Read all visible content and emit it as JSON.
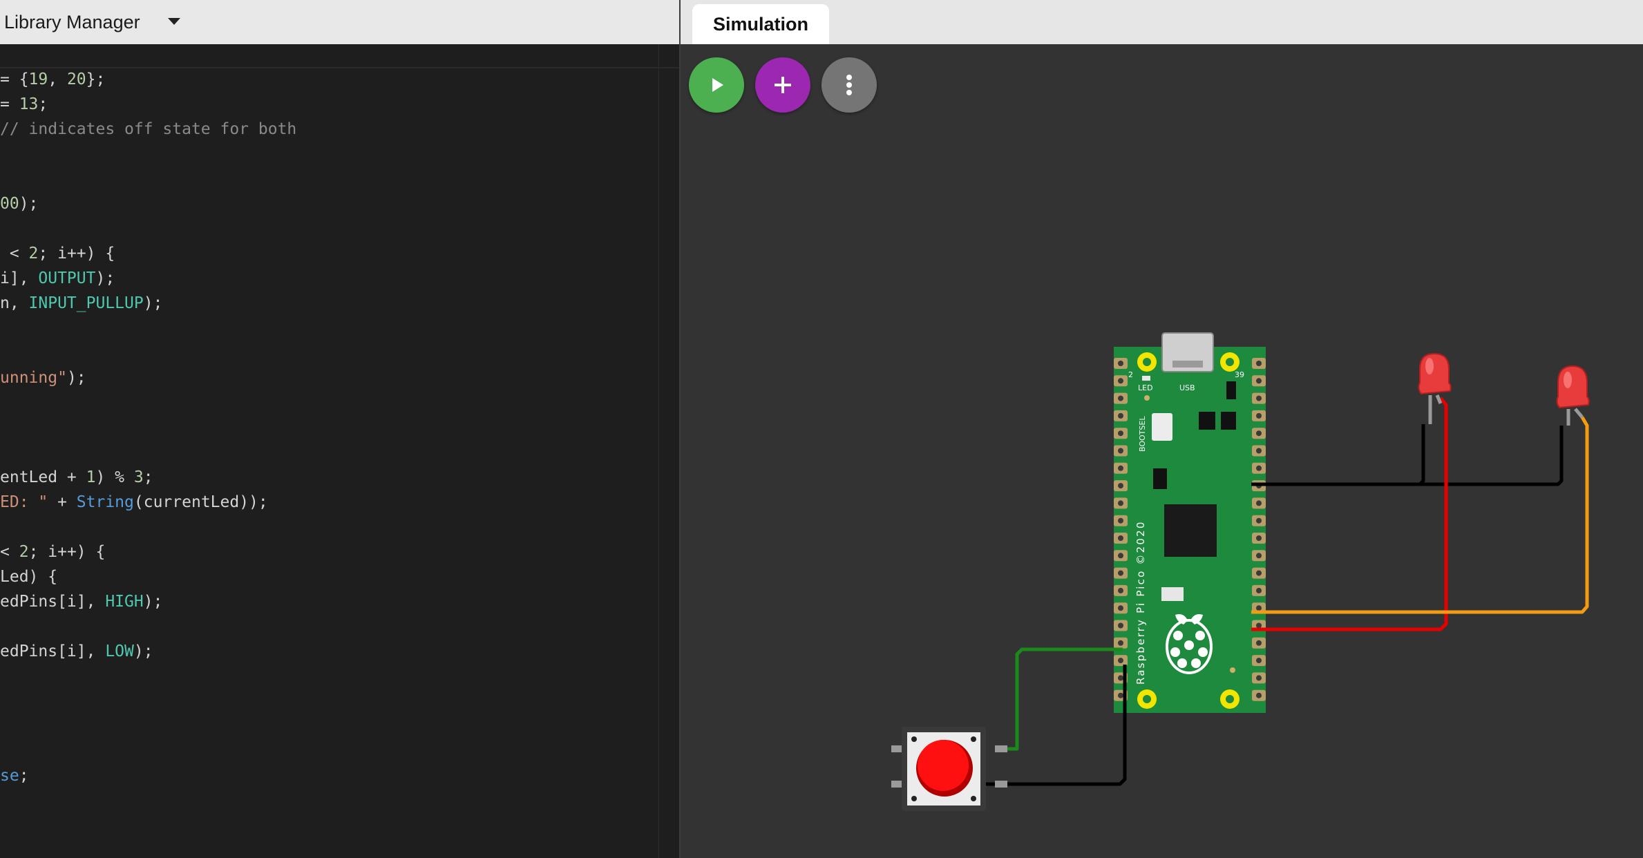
{
  "left_panel": {
    "tab_label": "Library Manager",
    "code_lines": [
      [
        {
          "t": "= {",
          "c": "plain"
        },
        {
          "t": "19",
          "c": "num"
        },
        {
          "t": ", ",
          "c": "plain"
        },
        {
          "t": "20",
          "c": "num"
        },
        {
          "t": "};",
          "c": "plain"
        }
      ],
      [
        {
          "t": "= ",
          "c": "plain"
        },
        {
          "t": "13",
          "c": "num"
        },
        {
          "t": ";",
          "c": "plain"
        }
      ],
      [
        {
          "t": "// indicates off state for both",
          "c": "gray"
        }
      ],
      [],
      [],
      [
        {
          "t": "00",
          "c": "num"
        },
        {
          "t": ");",
          "c": "plain"
        }
      ],
      [],
      [
        {
          "t": " < ",
          "c": "plain"
        },
        {
          "t": "2",
          "c": "num"
        },
        {
          "t": "; i++) {",
          "c": "plain"
        }
      ],
      [
        {
          "t": "i], ",
          "c": "plain"
        },
        {
          "t": "OUTPUT",
          "c": "const"
        },
        {
          "t": ");",
          "c": "plain"
        }
      ],
      [
        {
          "t": "n, ",
          "c": "plain"
        },
        {
          "t": "INPUT_PULLUP",
          "c": "const"
        },
        {
          "t": ");",
          "c": "plain"
        }
      ],
      [],
      [],
      [
        {
          "t": "unning\"",
          "c": "str"
        },
        {
          "t": ");",
          "c": "plain"
        }
      ],
      [],
      [],
      [],
      [
        {
          "t": "entLed + ",
          "c": "plain"
        },
        {
          "t": "1",
          "c": "num"
        },
        {
          "t": ") % ",
          "c": "plain"
        },
        {
          "t": "3",
          "c": "num"
        },
        {
          "t": ";",
          "c": "plain"
        }
      ],
      [
        {
          "t": "ED: \"",
          "c": "str"
        },
        {
          "t": " + ",
          "c": "plain"
        },
        {
          "t": "String",
          "c": "fn"
        },
        {
          "t": "(currentLed));",
          "c": "plain"
        }
      ],
      [],
      [
        {
          "t": "< ",
          "c": "plain"
        },
        {
          "t": "2",
          "c": "num"
        },
        {
          "t": "; i++) {",
          "c": "plain"
        }
      ],
      [
        {
          "t": "Led) {",
          "c": "plain"
        }
      ],
      [
        {
          "t": "edPins[i], ",
          "c": "plain"
        },
        {
          "t": "HIGH",
          "c": "const"
        },
        {
          "t": ");",
          "c": "plain"
        }
      ],
      [],
      [
        {
          "t": "edPins[i], ",
          "c": "plain"
        },
        {
          "t": "LOW",
          "c": "const"
        },
        {
          "t": ");",
          "c": "plain"
        }
      ],
      [],
      [],
      [],
      [],
      [
        {
          "t": "se",
          "c": "fn"
        },
        {
          "t": ";",
          "c": "plain"
        }
      ]
    ]
  },
  "right_panel": {
    "tab_label": "Simulation",
    "buttons": {
      "play": {
        "icon": "play-icon",
        "color": "#4caf50"
      },
      "add": {
        "icon": "plus-icon",
        "color": "#9c27b0"
      },
      "more": {
        "icon": "more-vertical-icon",
        "color": "#757575"
      }
    },
    "board": {
      "silkscreen": "Raspberry Pi Pico ©2020",
      "led_label": "LED",
      "usb_label": "USB",
      "bootsel_label": "BOOTSEL",
      "pin_left": "2",
      "pin_right": "39"
    },
    "components": [
      "raspberry-pi-pico",
      "led-1",
      "led-2",
      "pushbutton"
    ],
    "wire_colors": {
      "ground": "#000000",
      "led1": "#e60000",
      "led2": "#f39c12",
      "button": "#1a8a1a"
    }
  }
}
